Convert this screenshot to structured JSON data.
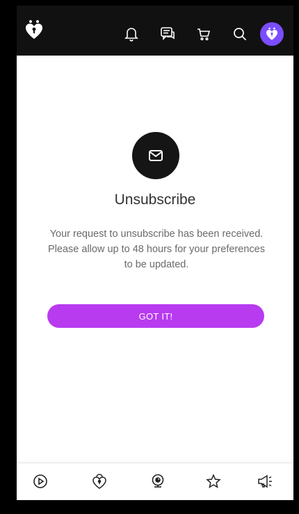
{
  "header": {
    "icons": [
      "bell-icon",
      "chat-icon",
      "cart-icon",
      "search-icon"
    ],
    "avatar_color": "#7b4dff",
    "background": "#111111"
  },
  "main": {
    "icon": "mail-icon",
    "title": "Unsubscribe",
    "message": "Your request to unsubscribe has been received. Please allow up to 48 hours for your preferences to be updated.",
    "button_label": "GOT IT!",
    "button_color": "#b83bf0"
  },
  "bottom_nav": {
    "items": [
      "play-icon",
      "lock-heart-icon",
      "webcam-icon",
      "star-icon",
      "megaphone-icon"
    ]
  }
}
